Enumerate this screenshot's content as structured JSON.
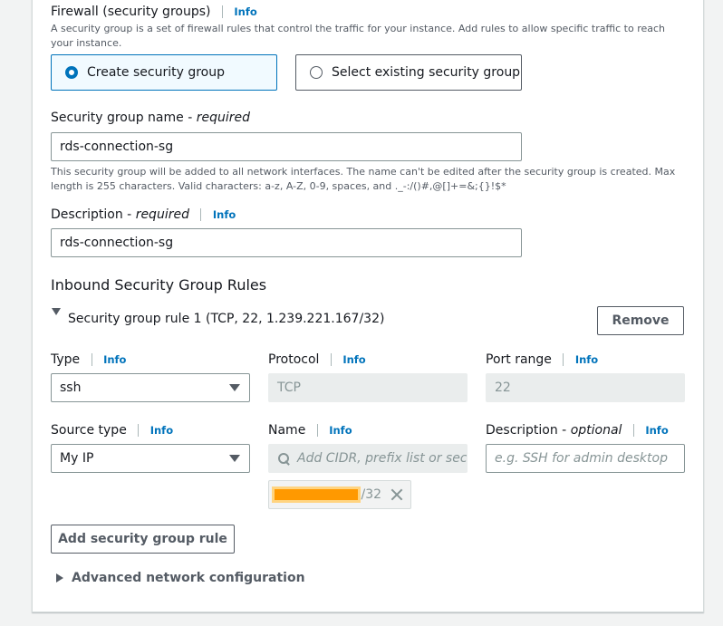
{
  "firewall": {
    "title": "Firewall (security groups)",
    "info": "Info",
    "description": "A security group is a set of firewall rules that control the traffic for your instance. Add rules to allow specific traffic to reach your instance.",
    "options": [
      {
        "label": "Create security group",
        "selected": true
      },
      {
        "label": "Select existing security group",
        "selected": false
      }
    ]
  },
  "sg_name": {
    "label": "Security group name - ",
    "required": "required",
    "value": "rds-connection-sg",
    "help": "This security group will be added to all network interfaces. The name can't be edited after the security group is created. Max length is 255 characters. Valid characters: a-z, A-Z, 0-9, spaces, and ._-:/()#,@[]+=&;{}!$*"
  },
  "description": {
    "label": "Description - ",
    "required": "required",
    "info": "Info",
    "value": "rds-connection-sg"
  },
  "inbound": {
    "title": "Inbound Security Group Rules",
    "rule_title": "Security group rule 1 (TCP, 22, 1.239.221.167/32)",
    "remove": "Remove",
    "type": {
      "label": "Type",
      "info": "Info",
      "value": "ssh"
    },
    "protocol": {
      "label": "Protocol",
      "info": "Info",
      "value": "TCP"
    },
    "port_range": {
      "label": "Port range",
      "info": "Info",
      "value": "22"
    },
    "source_type": {
      "label": "Source type",
      "info": "Info",
      "value": "My IP"
    },
    "name": {
      "label": "Name",
      "info": "Info",
      "placeholder": "Add CIDR, prefix list or securi",
      "token_suffix": "/32"
    },
    "desc": {
      "label": "Description - ",
      "optional": "optional",
      "info": "Info",
      "placeholder": "e.g. SSH for admin desktop"
    },
    "add_rule": "Add security group rule"
  },
  "advanced": "Advanced network configuration"
}
